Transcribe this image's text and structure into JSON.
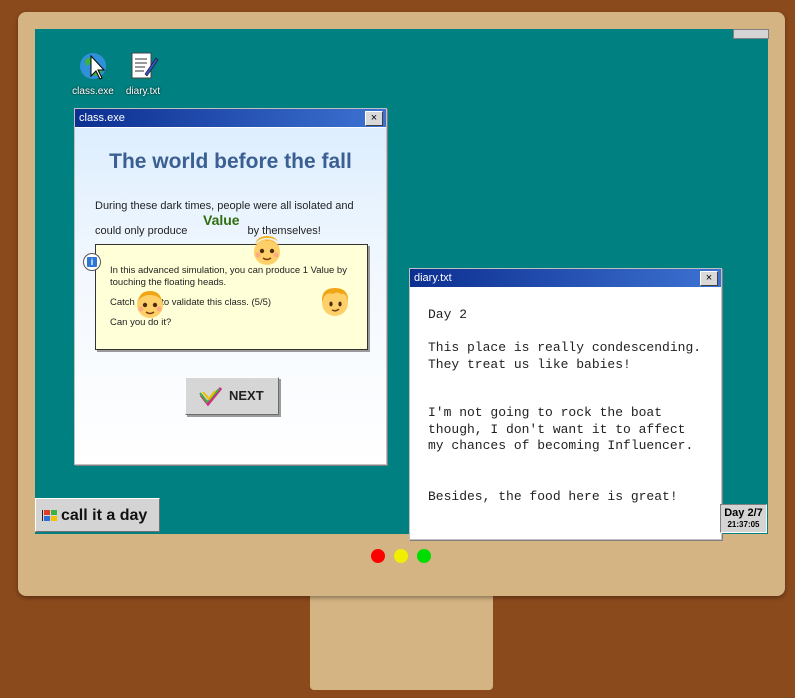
{
  "desktop": {
    "icons": [
      {
        "label": "class.exe",
        "icon": "class-exe-icon"
      },
      {
        "label": "diary.txt",
        "icon": "diary-txt-icon"
      }
    ]
  },
  "class_window": {
    "title": "class.exe",
    "close_label": "×",
    "heading": "The world before the fall",
    "para_line1": "During these dark times, people were all isolated and",
    "para_line2_a": "could only produce",
    "value_word": "Value",
    "para_line2_b": "by themselves!",
    "info": {
      "line1": "In this advanced simulation, you can produce 1 Value by",
      "line2": "touching the floating heads.",
      "line3": "Catch them to validate this class. (5/5)",
      "line4": "Can you do it?"
    },
    "next_label": "NEXT"
  },
  "diary_window": {
    "title": "diary.txt",
    "close_label": "×",
    "day": "Day 2",
    "p1": "This place is really condescending. They treat us like babies!",
    "p2": "I'm not going to rock the boat though, I don't want it to affect my chances of becoming Influencer.",
    "p3": "Besides, the food here is great!"
  },
  "taskbar": {
    "button_label": "call it a day",
    "clock_day": "Day 2/7",
    "clock_time": "21:37:05"
  },
  "colors": {
    "desktop": "#008080",
    "monitor": "#d4b483",
    "background": "#8a4a1c",
    "heading": "#3a5f93",
    "value": "#2f6e0d"
  }
}
